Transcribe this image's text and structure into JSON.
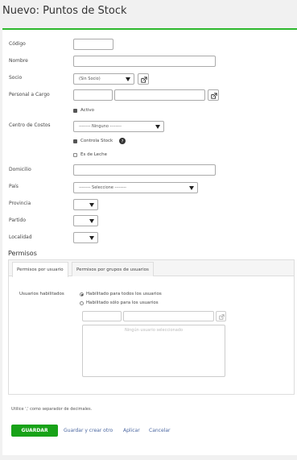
{
  "page": {
    "title": "Nuevo: Puntos de Stock"
  },
  "form": {
    "codigo": {
      "label": "Código",
      "value": ""
    },
    "nombre": {
      "label": "Nombre",
      "value": ""
    },
    "socio": {
      "label": "Socio",
      "selected": "(Sin Socio)"
    },
    "personal": {
      "label": "Personal a Cargo",
      "code": "",
      "name": ""
    },
    "activo": {
      "label": "Activo",
      "checked": true
    },
    "centro_costos": {
      "label": "Centro de Costos",
      "selected": "-------- Ninguno --------"
    },
    "controla_stock": {
      "label": "Controla Stock",
      "checked": true
    },
    "es_de_leche": {
      "label": "Es de Leche",
      "checked": false
    },
    "domicilio": {
      "label": "Domicilio",
      "value": ""
    },
    "pais": {
      "label": "País",
      "selected": "-------- Seleccione --------"
    },
    "provincia": {
      "label": "Provincia",
      "selected": ""
    },
    "partido": {
      "label": "Partido",
      "selected": ""
    },
    "localidad": {
      "label": "Localidad",
      "selected": ""
    }
  },
  "permisos": {
    "title": "Permisos",
    "tabs": [
      {
        "label": "Permisos por usuario",
        "active": true
      },
      {
        "label": "Permisos por grupos de usuarios",
        "active": false
      }
    ],
    "usuarios_label": "Usuarios habilitados",
    "options": [
      {
        "label": "Habilitado para todos los usuarios",
        "selected": true
      },
      {
        "label": "Habilitado sólo para los usuarios",
        "selected": false
      }
    ],
    "empty_text": "Ningún usuario seleccionado"
  },
  "footer": {
    "hint": "Utilice ',' como separador de decimales.",
    "save": "GUARDAR",
    "save_new": "Guardar y crear otro",
    "apply": "Aplicar",
    "cancel": "Cancelar"
  },
  "colors": {
    "accent": "#2db82d",
    "save_button": "#18a218",
    "link": "#4a66a0"
  }
}
